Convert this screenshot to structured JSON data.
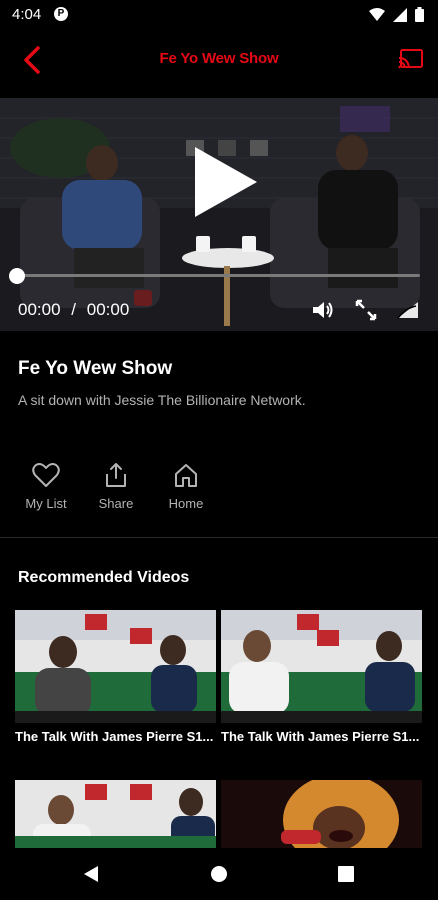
{
  "status_bar": {
    "time": "4:04"
  },
  "app_bar": {
    "title": "Fe Yo Wew Show"
  },
  "player": {
    "current_time": "00:00",
    "separator": "/",
    "duration": "00:00",
    "progress": 0
  },
  "show": {
    "title": "Fe Yo Wew Show",
    "description": "A sit down with Jessie The Billionaire Network."
  },
  "actions": [
    {
      "label": "My List",
      "icon": "heart-icon"
    },
    {
      "label": "Share",
      "icon": "share-icon"
    },
    {
      "label": "Home",
      "icon": "home-icon"
    }
  ],
  "recommended": {
    "heading": "Recommended Videos",
    "items": [
      {
        "label": "The Talk With James Pierre S1..."
      },
      {
        "label": "The Talk With James Pierre S1..."
      },
      {
        "label": ""
      },
      {
        "label": ""
      }
    ]
  },
  "colors": {
    "accent": "#e50914",
    "background": "#000000",
    "muted_text": "#b3b3b3"
  }
}
